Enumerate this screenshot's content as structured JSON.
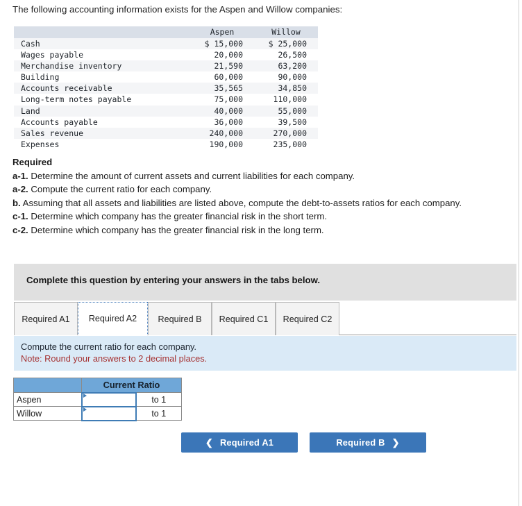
{
  "intro": {
    "text": "The following accounting information exists for the Aspen and Willow companies:"
  },
  "data_table": {
    "columns": [
      "",
      "Aspen",
      "Willow"
    ],
    "rows": [
      {
        "label": "Cash",
        "aspen": "$ 15,000",
        "willow": "$ 25,000"
      },
      {
        "label": "Wages payable",
        "aspen": "20,000",
        "willow": "26,500"
      },
      {
        "label": "Merchandise inventory",
        "aspen": "21,590",
        "willow": "63,200"
      },
      {
        "label": "Building",
        "aspen": "60,000",
        "willow": "90,000"
      },
      {
        "label": "Accounts receivable",
        "aspen": "35,565",
        "willow": "34,850"
      },
      {
        "label": "Long-term notes payable",
        "aspen": "75,000",
        "willow": "110,000"
      },
      {
        "label": "Land",
        "aspen": "40,000",
        "willow": "55,000"
      },
      {
        "label": "Accounts payable",
        "aspen": "36,000",
        "willow": "39,500"
      },
      {
        "label": "Sales revenue",
        "aspen": "240,000",
        "willow": "270,000"
      },
      {
        "label": "Expenses",
        "aspen": "190,000",
        "willow": "235,000"
      }
    ]
  },
  "required": {
    "heading": "Required",
    "items": [
      {
        "tag": "a-1.",
        "text": " Determine the amount of current assets and current liabilities for each company."
      },
      {
        "tag": "a-2.",
        "text": " Compute the current ratio for each company."
      },
      {
        "tag": "b.",
        "text": " Assuming that all assets and liabilities are listed above, compute the debt-to-assets ratios for each company."
      },
      {
        "tag": "c-1.",
        "text": " Determine which company has the greater financial risk in the short term."
      },
      {
        "tag": "c-2.",
        "text": " Determine which company has the greater financial risk in the long term."
      }
    ]
  },
  "banner": {
    "text": "Complete this question by entering your answers in the tabs below."
  },
  "tabs": {
    "items": [
      {
        "label": "Required A1",
        "active": false
      },
      {
        "label": "Required A2",
        "active": true
      },
      {
        "label": "Required B",
        "active": false
      },
      {
        "label": "Required C1",
        "active": false
      },
      {
        "label": "Required C2",
        "active": false
      }
    ]
  },
  "note_panel": {
    "instruction": "Compute the current ratio for each company.",
    "note": "Note: Round your answers to 2 decimal places."
  },
  "answer_table": {
    "header": {
      "blank": "",
      "ratio": "Current Ratio"
    },
    "rows": [
      {
        "name": "Aspen",
        "value": "",
        "unit": "to 1"
      },
      {
        "name": "Willow",
        "value": "",
        "unit": "to 1"
      }
    ]
  },
  "nav": {
    "prev_label": "Required A1",
    "prev_icon": "chevron-left",
    "next_label": "Required B",
    "next_icon": "chevron-right"
  },
  "colors": {
    "accent_blue": "#3b76b8",
    "table_header_blue": "#6fa7d8",
    "data_header": "#d9dfe8",
    "banner_grey": "#e0e0e0",
    "note_panel_blue": "#daeaf7",
    "note_red": "#a63232"
  }
}
